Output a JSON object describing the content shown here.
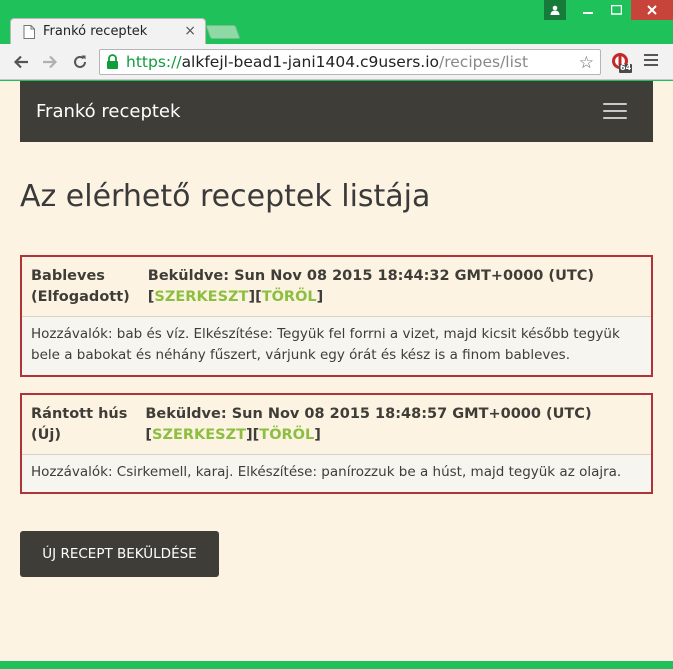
{
  "browser": {
    "tab_title": "Frankó receptek",
    "url_scheme": "https://",
    "url_host": "alkfejl-bead1-jani1404.c9users.io",
    "url_path": "/recipes/list",
    "extension_badge": "64"
  },
  "navbar": {
    "brand": "Frankó receptek"
  },
  "page": {
    "title": "Az elérhető receptek listája"
  },
  "recipes": [
    {
      "name": "Bableves",
      "status": "(Elfogadott)",
      "submitted": "Beküldve: Sun Nov 08 2015 18:44:32 GMT+0000 (UTC)",
      "edit_label": "SZERKESZT",
      "delete_label": "TÖRÖL",
      "description": "Hozzávalók: bab és víz. Elkészítése: Tegyük fel forrni a vizet, majd kicsit később tegyük bele a babokat és néhány fűszert, várjunk egy órát és kész is a finom bableves."
    },
    {
      "name": "Rántott hús",
      "status": "(Új)",
      "submitted": "Beküldve: Sun Nov 08 2015 18:48:57 GMT+0000 (UTC)",
      "edit_label": "SZERKESZT",
      "delete_label": "TÖRÖL",
      "description": "Hozzávalók: Csirkemell, karaj. Elkészítése: panírozzuk be a húst, majd tegyük az olajra."
    }
  ],
  "actions": {
    "new_recipe_label": "ÚJ RECEPT BEKÜLDÉSE"
  },
  "colors": {
    "accent_link": "#8cbf3f",
    "card_border": "#b0333a",
    "navbar_bg": "#3e3d37",
    "page_bg": "#fdf3e3"
  }
}
